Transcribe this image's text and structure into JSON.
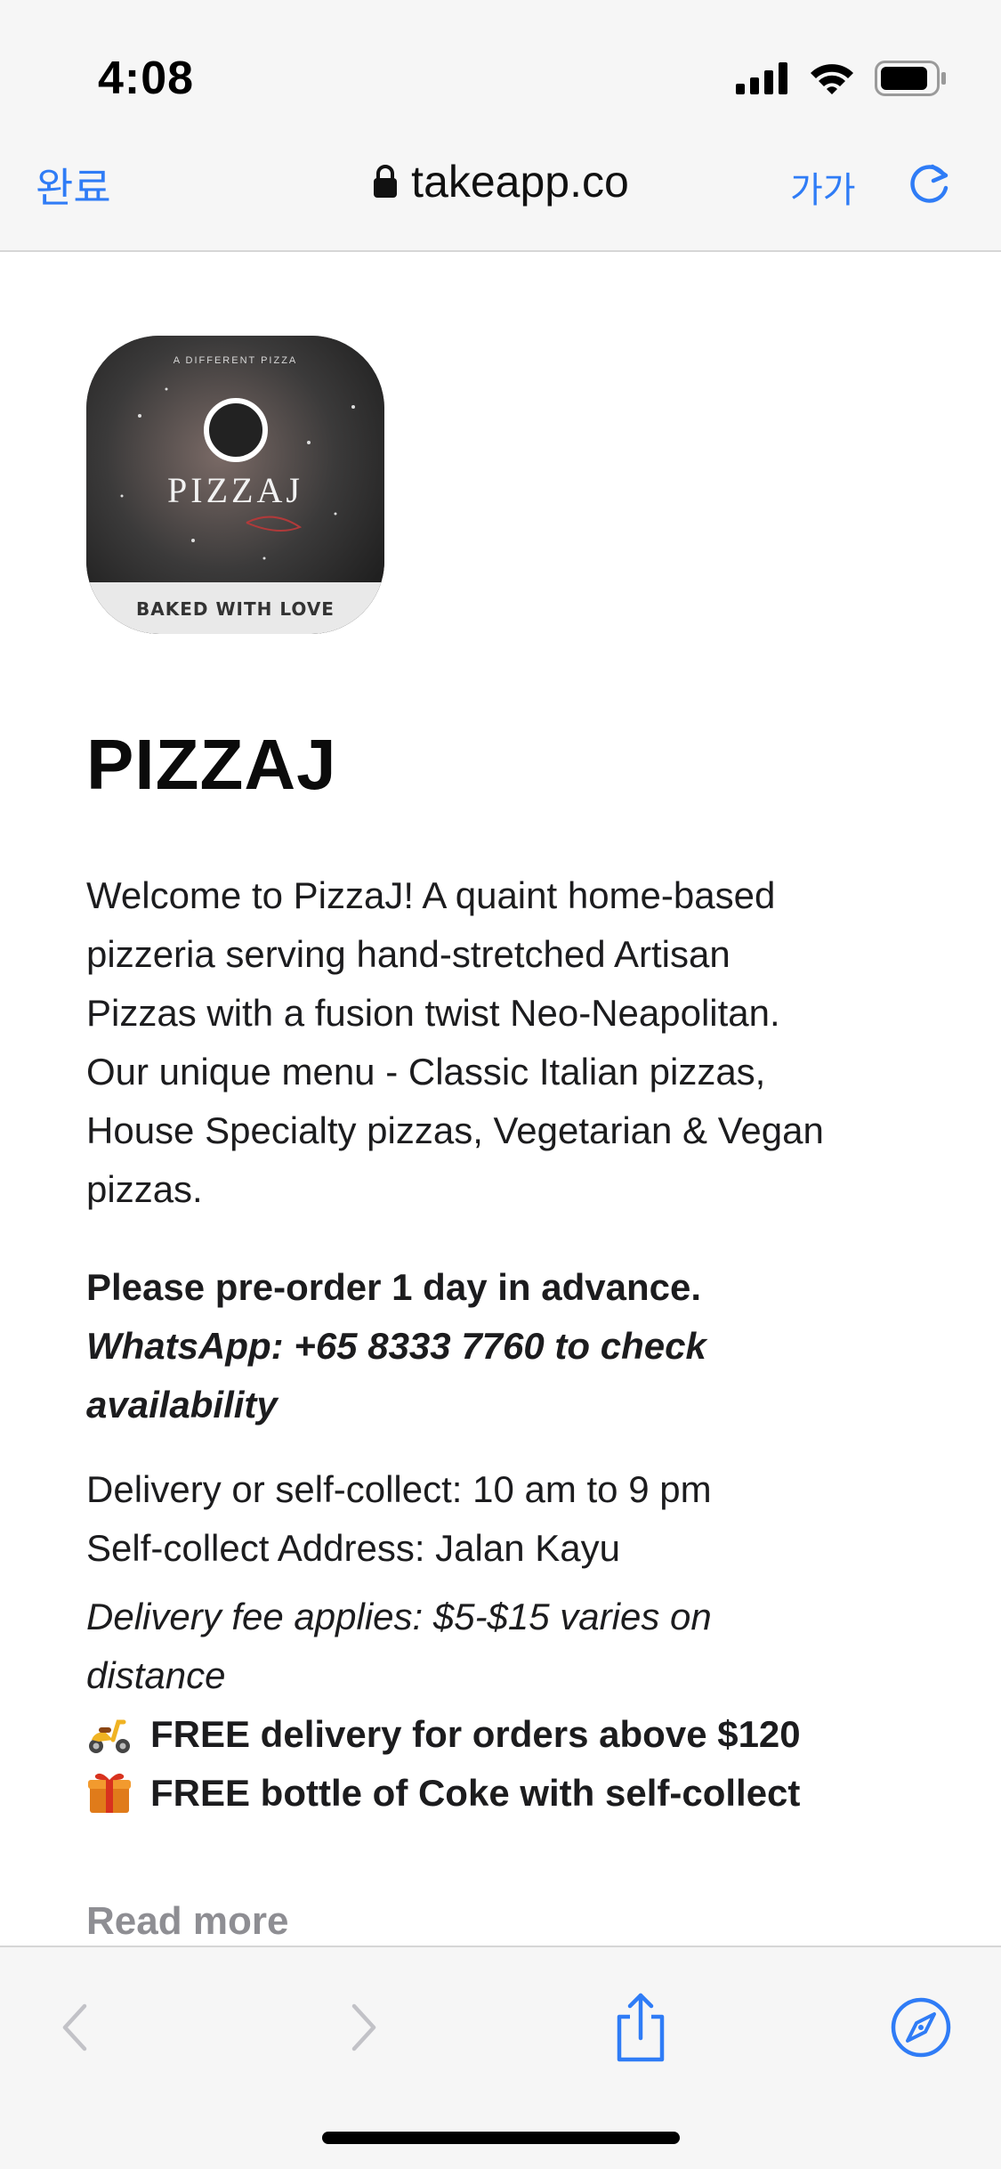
{
  "status_bar": {
    "time": "4:08",
    "icons": [
      "signal-icon",
      "wifi-icon",
      "battery-icon"
    ]
  },
  "browser": {
    "done_label": "완료",
    "url": "takeapp.co",
    "text_size_label": "가가",
    "icons": [
      "lock-icon",
      "reload-icon",
      "back-icon",
      "forward-icon",
      "share-icon",
      "compass-icon"
    ],
    "accent_color": "#2f7cf6"
  },
  "shop": {
    "logo": {
      "tagline": "A DIFFERENT PIZZA",
      "name": "PIZZAJ",
      "slogan": "BAKED WITH LOVE"
    },
    "title": "PIZZAJ",
    "description": {
      "intro_lines": [
        "Welcome to PizzaJ! A quaint home-based",
        "pizzeria serving hand-stretched Artisan",
        "Pizzas with a fusion twist Neo-Neapolitan.",
        "Our unique menu - Classic Italian pizzas,",
        "House Specialty pizzas, Vegetarian & Vegan",
        "pizzas."
      ],
      "preorder": "Please pre-order 1 day in advance.",
      "whatsapp_lines": [
        "WhatsApp: +65 8333 7760 to check",
        "availability"
      ],
      "hours": "Delivery or self-collect: 10 am to 9 pm",
      "address": "Self-collect Address: Jalan Kayu",
      "fee_lines": [
        "Delivery fee applies: $5-$15 varies on",
        "distance"
      ],
      "free_delivery": "FREE delivery for orders above $120",
      "free_coke": "FREE bottle of Coke with self-collect"
    },
    "read_more": "Read more"
  }
}
